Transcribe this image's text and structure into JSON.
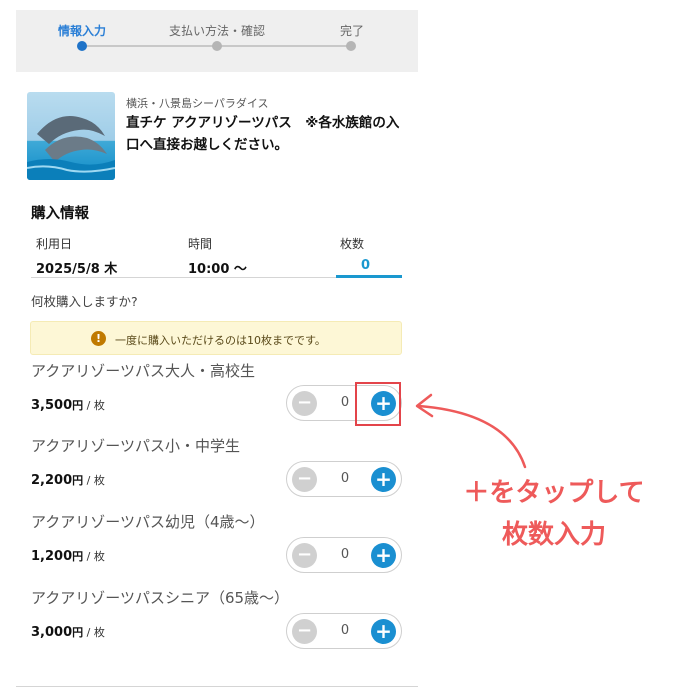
{
  "stepper": {
    "steps": [
      {
        "label": "情報入力",
        "active": true
      },
      {
        "label": "支払い方法・確認",
        "active": false
      },
      {
        "label": "完了",
        "active": false
      }
    ]
  },
  "product": {
    "venue": "横浜・八景島シーパラダイス",
    "title": "直チケ アクアリゾーツパス　※各水族館の入口へ直接お越しください。"
  },
  "purchase": {
    "section_title": "購入情報",
    "date_label": "利用日",
    "date_value": "2025/5/8 木",
    "time_label": "時間",
    "time_value": "10:00 〜",
    "count_label": "枚数",
    "count_value": "0"
  },
  "question": "何枚購入しますか?",
  "notice": {
    "icon": "warning-icon",
    "text": "一度に購入いただけるのは10枚までです。"
  },
  "tickets": [
    {
      "name": "アクアリゾーツパス大人・高校生",
      "price": "3,500",
      "yen": "円",
      "unit": " / 枚",
      "qty": "0"
    },
    {
      "name": "アクアリゾーツパス小・中学生",
      "price": "2,200",
      "yen": "円",
      "unit": " / 枚",
      "qty": "0"
    },
    {
      "name": "アクアリゾーツパス幼児（4歳〜）",
      "price": "1,200",
      "yen": "円",
      "unit": " / 枚",
      "qty": "0"
    },
    {
      "name": "アクアリゾーツパスシニア（65歳〜）",
      "price": "3,000",
      "yen": "円",
      "unit": " / 枚",
      "qty": "0"
    }
  ],
  "controls": {
    "minus": "−",
    "plus": "+"
  },
  "annotation": {
    "line1": "＋をタップして",
    "line2": "枚数入力"
  },
  "colors": {
    "accent": "#1a8fd1",
    "annotation": "#ee5a5a",
    "notice_bg": "#fdf7d6"
  }
}
